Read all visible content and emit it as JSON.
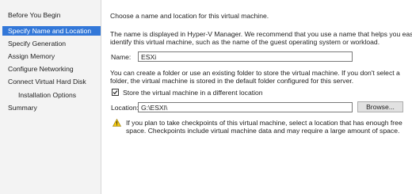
{
  "sidebar": {
    "items": [
      {
        "label": "Before You Begin"
      },
      {
        "label": "Specify Name and Location"
      },
      {
        "label": "Specify Generation"
      },
      {
        "label": "Assign Memory"
      },
      {
        "label": "Configure Networking"
      },
      {
        "label": "Connect Virtual Hard Disk"
      },
      {
        "label": "Installation Options"
      },
      {
        "label": "Summary"
      }
    ],
    "selected": "Specify Name and Location"
  },
  "main": {
    "heading": "Choose a name and location for this virtual machine.",
    "description_line1": "The name is displayed in Hyper-V Manager. We recommend that you use a name that helps you easily",
    "description_line2": "identify this virtual machine, such as the name of the guest operating system or workload.",
    "name_label": "Name:",
    "name_value": "ESXi",
    "folder_info_line1": "You can create a folder or use an existing folder to store the virtual machine. If you don't select a",
    "folder_info_line2": "folder, the virtual machine is stored in the default folder configured for this server.",
    "store_checkbox_label": "Store the virtual machine in a different location",
    "store_checkbox_checked": true,
    "location_label": "Location:",
    "location_value": "G:\\ESXI\\",
    "browse_label": "Browse...",
    "warning_line1": "If you plan to take checkpoints of this virtual machine, select a location that has enough free",
    "warning_line2": "space. Checkpoints include virtual machine data and may require a large amount of space.",
    "warning_icon": "warning-icon"
  },
  "colors": {
    "selection": "#3277d8",
    "sidebar_bg": "#f3f3f3",
    "warning": "#f2c811"
  }
}
